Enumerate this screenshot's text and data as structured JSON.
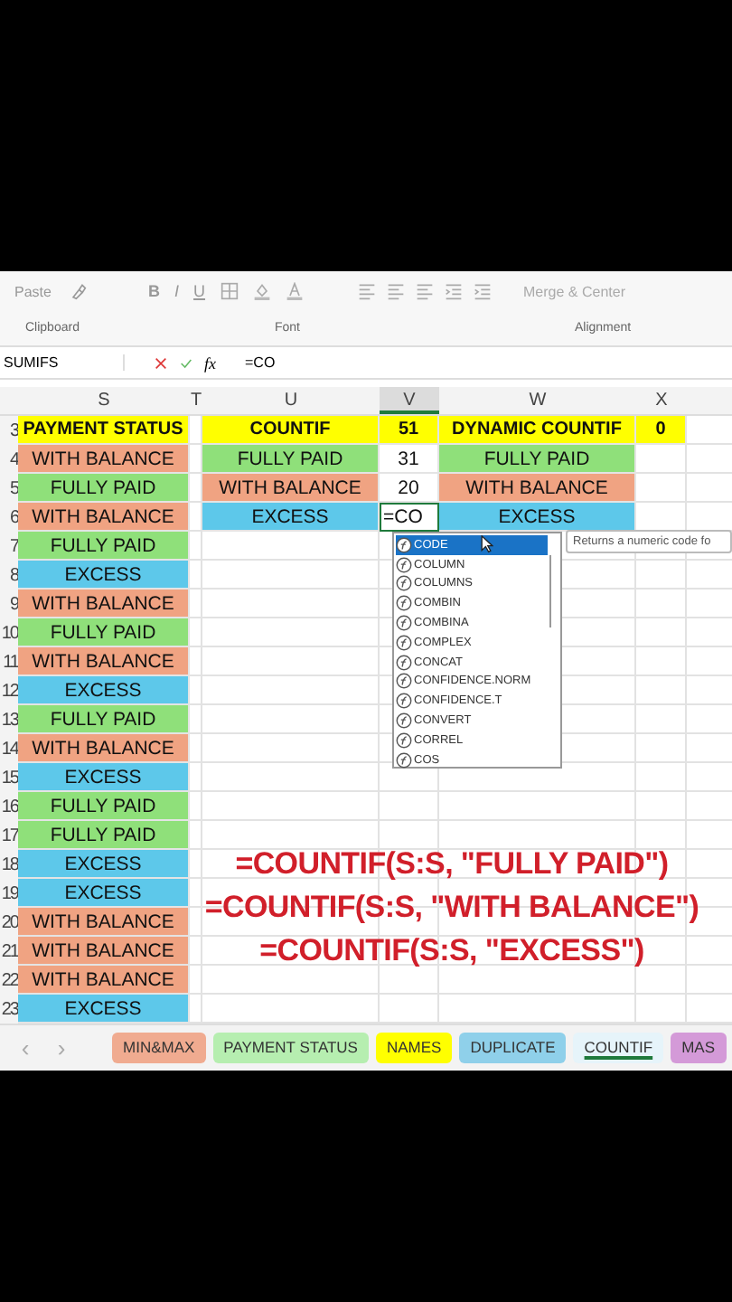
{
  "ribbon": {
    "paste_label": "Paste",
    "font_buttons": [
      "B",
      "I",
      "U"
    ],
    "merge_label": "Merge & Center",
    "groups": [
      {
        "label": "Clipboard"
      },
      {
        "label": "Font"
      },
      {
        "label": "Alignment"
      }
    ]
  },
  "formula_bar": {
    "name_box": "SUMIFS",
    "fx_label": "fx",
    "formula": "=CO"
  },
  "sheet_nav": {
    "previous": "‹",
    "next": "›"
  },
  "columns": [
    {
      "label": "S",
      "selected": false
    },
    {
      "label": "T",
      "selected": false
    },
    {
      "label": "U",
      "selected": false
    },
    {
      "label": "V",
      "selected": true
    },
    {
      "label": "W",
      "selected": false
    },
    {
      "label": "X",
      "selected": false
    }
  ],
  "rows": [
    {
      "number": "3",
      "kind": "header",
      "cells": {
        "S": {
          "text": "PAYMENT STATUS",
          "color": "#ffff00"
        },
        "U": {
          "text": "COUNTIF",
          "color": "#ffff00"
        },
        "V": {
          "text": "51",
          "color": "#ffff00"
        },
        "W": {
          "text": "DYNAMIC COUNTIF",
          "color": "#ffff00"
        },
        "X": {
          "text": "0",
          "color": "#ffff00"
        }
      }
    },
    {
      "number": "4",
      "kind": "data",
      "cells": {
        "S": {
          "text": "WITH BALANCE",
          "color": "#f0a382"
        },
        "U": {
          "text": "FULLY PAID",
          "color": "#8fe07a"
        },
        "V": {
          "text": "31"
        },
        "W": {
          "text": "FULLY PAID",
          "color": "#8fe07a"
        }
      }
    },
    {
      "number": "5",
      "kind": "data",
      "cells": {
        "S": {
          "text": "FULLY PAID",
          "color": "#8fe07a"
        },
        "U": {
          "text": "WITH BALANCE",
          "color": "#f0a382"
        },
        "V": {
          "text": "20"
        },
        "W": {
          "text": "WITH BALANCE",
          "color": "#f0a382"
        }
      }
    },
    {
      "number": "6",
      "kind": "data",
      "cells": {
        "S": {
          "text": "WITH BALANCE",
          "color": "#f0a382"
        },
        "U": {
          "text": "EXCESS",
          "color": "#5dc8ea"
        },
        "V": {
          "text": "=CO",
          "editing": true
        },
        "W": {
          "text": "EXCESS",
          "color": "#5dc8ea"
        }
      }
    },
    {
      "number": "7",
      "kind": "data",
      "cells": {
        "S": {
          "text": "FULLY PAID",
          "color": "#8fe07a"
        }
      }
    },
    {
      "number": "8",
      "kind": "data",
      "cells": {
        "S": {
          "text": "EXCESS",
          "color": "#5dc8ea"
        }
      }
    },
    {
      "number": "9",
      "kind": "data",
      "cells": {
        "S": {
          "text": "WITH BALANCE",
          "color": "#f0a382"
        }
      }
    },
    {
      "number": "10",
      "kind": "data",
      "cells": {
        "S": {
          "text": "FULLY PAID",
          "color": "#8fe07a"
        }
      }
    },
    {
      "number": "11",
      "kind": "data",
      "cells": {
        "S": {
          "text": "WITH BALANCE",
          "color": "#f0a382"
        }
      }
    },
    {
      "number": "12",
      "kind": "data",
      "cells": {
        "S": {
          "text": "EXCESS",
          "color": "#5dc8ea"
        }
      }
    },
    {
      "number": "13",
      "kind": "data",
      "cells": {
        "S": {
          "text": "FULLY PAID",
          "color": "#8fe07a"
        }
      }
    },
    {
      "number": "14",
      "kind": "data",
      "cells": {
        "S": {
          "text": "WITH BALANCE",
          "color": "#f0a382"
        }
      }
    },
    {
      "number": "15",
      "kind": "data",
      "cells": {
        "S": {
          "text": "EXCESS",
          "color": "#5dc8ea"
        }
      }
    },
    {
      "number": "16",
      "kind": "data",
      "cells": {
        "S": {
          "text": "FULLY PAID",
          "color": "#8fe07a"
        }
      }
    },
    {
      "number": "17",
      "kind": "data",
      "cells": {
        "S": {
          "text": "FULLY PAID",
          "color": "#8fe07a"
        }
      }
    },
    {
      "number": "18",
      "kind": "data",
      "cells": {
        "S": {
          "text": "EXCESS",
          "color": "#5dc8ea"
        }
      }
    },
    {
      "number": "19",
      "kind": "data",
      "cells": {
        "S": {
          "text": "EXCESS",
          "color": "#5dc8ea"
        }
      }
    },
    {
      "number": "20",
      "kind": "data",
      "cells": {
        "S": {
          "text": "WITH BALANCE",
          "color": "#f0a382"
        }
      }
    },
    {
      "number": "21",
      "kind": "data",
      "cells": {
        "S": {
          "text": "WITH BALANCE",
          "color": "#f0a382"
        }
      }
    },
    {
      "number": "22",
      "kind": "data",
      "cells": {
        "S": {
          "text": "WITH BALANCE",
          "color": "#f0a382"
        }
      }
    },
    {
      "number": "23",
      "kind": "data",
      "cells": {
        "S": {
          "text": "EXCESS",
          "color": "#5dc8ea"
        }
      }
    }
  ],
  "autocomplete": {
    "items": [
      {
        "label": "CODE",
        "selected": true
      },
      {
        "label": "COLUMN",
        "selected": false
      },
      {
        "label": "COLUMNS",
        "selected": false
      },
      {
        "label": "COMBIN",
        "selected": false
      },
      {
        "label": "COMBINA",
        "selected": false
      },
      {
        "label": "COMPLEX",
        "selected": false
      },
      {
        "label": "CONCAT",
        "selected": false
      },
      {
        "label": "CONFIDENCE.NORM",
        "selected": false
      },
      {
        "label": "CONFIDENCE.T",
        "selected": false
      },
      {
        "label": "CONVERT",
        "selected": false
      },
      {
        "label": "CORREL",
        "selected": false
      },
      {
        "label": "COS",
        "selected": false
      }
    ],
    "tooltip": "Returns a numeric code fo"
  },
  "overlay_lines": [
    "=COUNTIF(S:S, \"FULLY PAID\")",
    "=COUNTIF(S:S, \"WITH BALANCE\")",
    "=COUNTIF(S:S, \"EXCESS\")"
  ],
  "sheet_tabs": [
    {
      "label": "MIN&MAX",
      "color": "#f0ab90",
      "selected": false
    },
    {
      "label": "PAYMENT STATUS",
      "color": "#b6eeb0",
      "selected": false
    },
    {
      "label": "NAMES",
      "color": "#ffff00",
      "selected": false
    },
    {
      "label": "DUPLICATE",
      "color": "#8fd0ea",
      "selected": false
    },
    {
      "label": "COUNTIF",
      "color": "#e6f4fa",
      "selected": true
    },
    {
      "label": "MAS",
      "color": "#d49ad8",
      "selected": false
    }
  ]
}
